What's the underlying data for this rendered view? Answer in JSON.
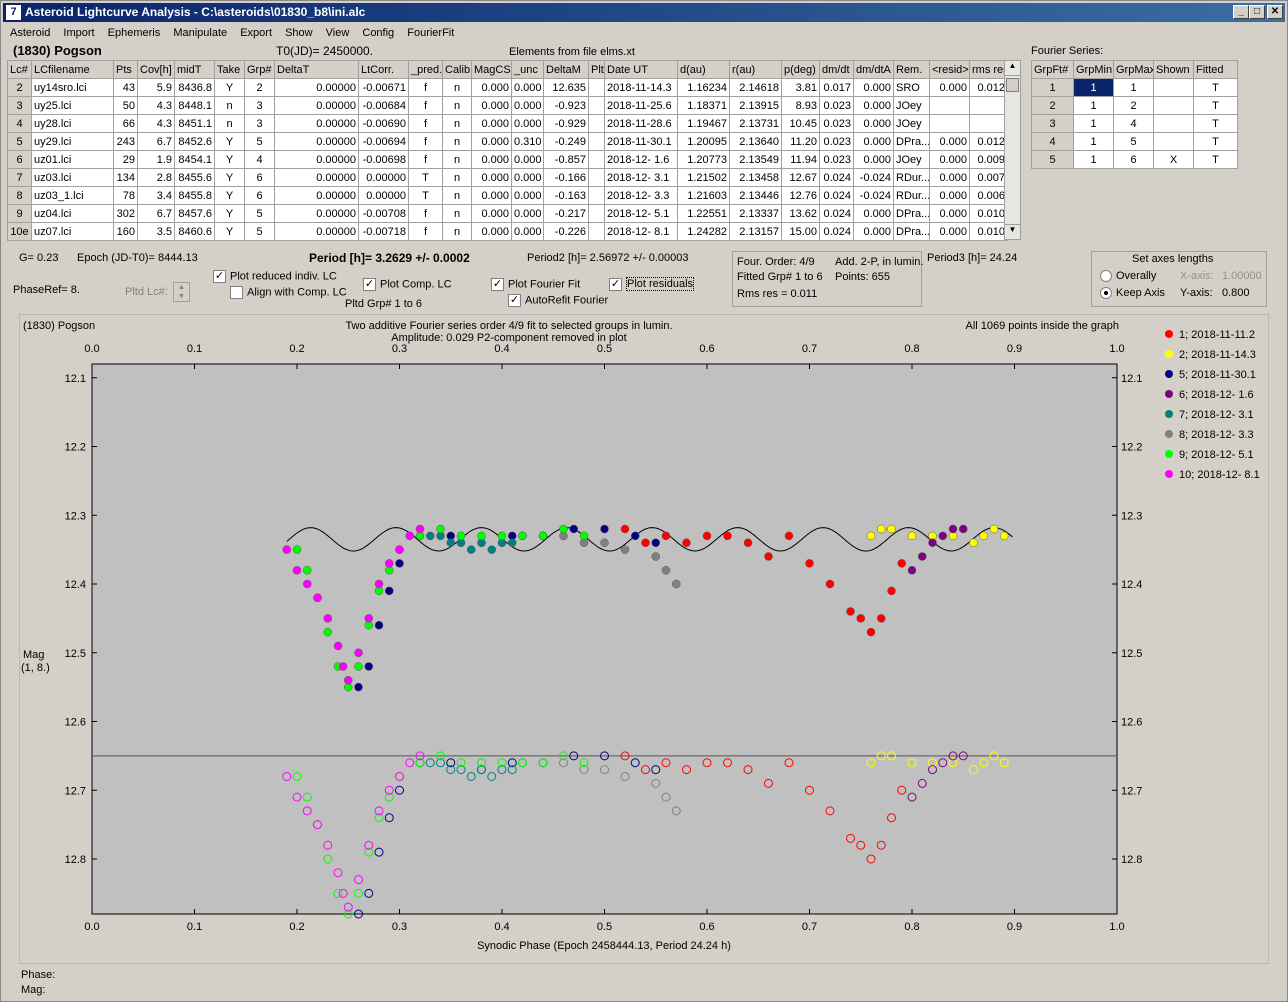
{
  "window": {
    "title": "Asteroid Lightcurve Analysis - C:\\asteroids\\01830_b8\\ini.alc"
  },
  "menu": [
    "Asteroid",
    "Import",
    "Ephemeris",
    "Manipulate",
    "Export",
    "Show",
    "View",
    "Config",
    "FourierFit"
  ],
  "header": {
    "asteroid": "(1830) Pogson",
    "t0": "T0(JD)= 2450000.",
    "elements": "Elements from file elms.xt",
    "fourier_title": "Fourier Series:"
  },
  "lc_table": {
    "columns": [
      "Lc#",
      "LCfilename",
      "Pts",
      "Cov[h]",
      "midT",
      "Take",
      "Grp#",
      "DeltaT",
      "LtCorr.",
      "_pred.",
      "Calib",
      "MagCS",
      "_unc",
      "DeltaM",
      "Plt",
      "Date UT",
      "d(au)",
      "r(au)",
      "p(deg)",
      "dm/dt",
      "dm/dtA",
      "Rem.",
      "<resid>",
      "rms res"
    ],
    "rows": [
      [
        "2",
        "uy14sro.lci",
        "43",
        "5.9",
        "8436.8",
        "Y",
        "2",
        "0.00000",
        "-0.00671",
        "f",
        "n",
        "0.000",
        "0.000",
        "12.635",
        "",
        "2018-11-14.3",
        "1.16234",
        "2.14618",
        "3.81",
        "0.017",
        "0.000",
        "SRO",
        "0.000",
        "0.012"
      ],
      [
        "3",
        "uy25.lci",
        "50",
        "4.3",
        "8448.1",
        "n",
        "3",
        "0.00000",
        "-0.00684",
        "f",
        "n",
        "0.000",
        "0.000",
        "-0.923",
        "",
        "2018-11-25.6",
        "1.18371",
        "2.13915",
        "8.93",
        "0.023",
        "0.000",
        "JOey",
        "",
        ""
      ],
      [
        "4",
        "uy28.lci",
        "66",
        "4.3",
        "8451.1",
        "n",
        "3",
        "0.00000",
        "-0.00690",
        "f",
        "n",
        "0.000",
        "0.000",
        "-0.929",
        "",
        "2018-11-28.6",
        "1.19467",
        "2.13731",
        "10.45",
        "0.023",
        "0.000",
        "JOey",
        "",
        ""
      ],
      [
        "5",
        "uy29.lci",
        "243",
        "6.7",
        "8452.6",
        "Y",
        "5",
        "0.00000",
        "-0.00694",
        "f",
        "n",
        "0.000",
        "0.310",
        "-0.249",
        "",
        "2018-11-30.1",
        "1.20095",
        "2.13640",
        "11.20",
        "0.023",
        "0.000",
        "DPra...",
        "0.000",
        "0.012"
      ],
      [
        "6",
        "uz01.lci",
        "29",
        "1.9",
        "8454.1",
        "Y",
        "4",
        "0.00000",
        "-0.00698",
        "f",
        "n",
        "0.000",
        "0.000",
        "-0.857",
        "",
        "2018-12- 1.6",
        "1.20773",
        "2.13549",
        "11.94",
        "0.023",
        "0.000",
        "JOey",
        "0.000",
        "0.009"
      ],
      [
        "7",
        "uz03.lci",
        "134",
        "2.8",
        "8455.6",
        "Y",
        "6",
        "0.00000",
        "0.00000",
        "T",
        "n",
        "0.000",
        "0.000",
        "-0.166",
        "",
        "2018-12- 3.1",
        "1.21502",
        "2.13458",
        "12.67",
        "0.024",
        "-0.024",
        "RDur...",
        "0.000",
        "0.007"
      ],
      [
        "8",
        "uz03_1.lci",
        "78",
        "3.4",
        "8455.8",
        "Y",
        "6",
        "0.00000",
        "0.00000",
        "T",
        "n",
        "0.000",
        "0.000",
        "-0.163",
        "",
        "2018-12- 3.3",
        "1.21603",
        "2.13446",
        "12.76",
        "0.024",
        "-0.024",
        "RDur...",
        "0.000",
        "0.006"
      ],
      [
        "9",
        "uz04.lci",
        "302",
        "6.7",
        "8457.6",
        "Y",
        "5",
        "0.00000",
        "-0.00708",
        "f",
        "n",
        "0.000",
        "0.000",
        "-0.217",
        "",
        "2018-12- 5.1",
        "1.22551",
        "2.13337",
        "13.62",
        "0.024",
        "0.000",
        "DPra...",
        "0.000",
        "0.010"
      ],
      [
        "10e",
        "uz07.lci",
        "160",
        "3.5",
        "8460.6",
        "Y",
        "5",
        "0.00000",
        "-0.00718",
        "f",
        "n",
        "0.000",
        "0.000",
        "-0.226",
        "",
        "2018-12- 8.1",
        "1.24282",
        "2.13157",
        "15.00",
        "0.024",
        "0.000",
        "DPra...",
        "0.000",
        "0.010"
      ]
    ]
  },
  "fourier_table": {
    "columns": [
      "GrpFt#",
      "GrpMin",
      "GrpMax",
      "Shown",
      "Fitted"
    ],
    "rows": [
      [
        "1",
        "1",
        "1",
        "",
        "T"
      ],
      [
        "2",
        "1",
        "2",
        "",
        "T"
      ],
      [
        "3",
        "1",
        "4",
        "",
        "T"
      ],
      [
        "4",
        "1",
        "5",
        "",
        "T"
      ],
      [
        "5",
        "1",
        "6",
        "X",
        "T"
      ]
    ]
  },
  "info": {
    "g": "G= 0.23",
    "epoch": "Epoch (JD-T0)= 8444.13",
    "period": "Period [h]= 3.2629 +/- 0.0002",
    "period2": "Period2 [h]= 2.56972 +/- 0.00003",
    "period3": "Period3 [h]= 24.24",
    "phase_ref": "PhaseRef= 8.",
    "pltd_lc": "Pltd Lc#:",
    "pltd_grp": "Pltd Grp#  1  to  6"
  },
  "checkboxes": {
    "plot_reduced": {
      "label": "Plot reduced indiv. LC",
      "checked": "✓"
    },
    "align_comp": {
      "label": "Align with Comp. LC",
      "checked": ""
    },
    "plot_comp": {
      "label": "Plot Comp. LC",
      "checked": "✓"
    },
    "plot_fourier": {
      "label": "Plot Fourier Fit",
      "checked": "✓"
    },
    "plot_residuals": {
      "label": "Plot residuals",
      "checked": "✓"
    },
    "autorefit": {
      "label": "AutoRefit Fourier",
      "checked": "✓"
    }
  },
  "fit_info": {
    "order": "Four. Order:  4/9",
    "add": "Add. 2-P, in lumin.",
    "fitted": "Fitted Grp# 1 to 6",
    "points": "Points: 655",
    "rms": "Rms res     = 0.011"
  },
  "axes_panel": {
    "title": "Set axes lengths",
    "overally": "Overally",
    "keep_axis": "Keep Axis",
    "xaxis_label": "X-axis:",
    "xaxis_value": "1.00000",
    "yaxis_label": "Y-axis:",
    "yaxis_value": "0.800"
  },
  "footer": {
    "phase": "Phase:",
    "mag": "Mag:"
  },
  "chart_data": {
    "type": "scatter",
    "title": "Two additive Fourier series order 4/9 fit to selected groups in lumin.",
    "subtitle": "Amplitude: 0.029          P2-component removed in plot",
    "object_label": "(1830) Pogson",
    "points_note": "All 1069 points inside the graph",
    "xlabel": "Synodic Phase (Epoch 2458444.13, Period 24.24 h)",
    "ylabel": "Mag",
    "ylabel2": "(1, 8.)",
    "xlim": [
      0,
      1
    ],
    "ylim": [
      12.8,
      12.1
    ],
    "x_ticks": [
      "0.0",
      "0.1",
      "0.2",
      "0.3",
      "0.4",
      "0.5",
      "0.6",
      "0.7",
      "0.8",
      "0.9",
      "1.0"
    ],
    "y_ticks": [
      "12.1",
      "12.2",
      "12.3",
      "12.4",
      "12.5",
      "12.6",
      "12.7",
      "12.8"
    ],
    "residual_offset": 0.33,
    "reference_line": 12.65,
    "legend": "right",
    "series": [
      {
        "name": "1; 2018-11-11.2",
        "color": "#ff0000",
        "x": [
          0.52,
          0.54,
          0.56,
          0.58,
          0.6,
          0.62,
          0.64,
          0.66,
          0.68,
          0.7,
          0.72,
          0.74,
          0.75,
          0.76,
          0.77,
          0.78,
          0.79
        ],
        "y": [
          12.32,
          12.34,
          12.33,
          12.34,
          12.33,
          12.33,
          12.34,
          12.36,
          12.33,
          12.37,
          12.4,
          12.44,
          12.45,
          12.47,
          12.45,
          12.41,
          12.37
        ]
      },
      {
        "name": "2; 2018-11-14.3",
        "color": "#ffff00",
        "x": [
          0.76,
          0.77,
          0.78,
          0.8,
          0.82,
          0.84,
          0.86,
          0.87,
          0.88,
          0.89
        ],
        "y": [
          12.33,
          12.32,
          12.32,
          12.33,
          12.33,
          12.33,
          12.34,
          12.33,
          12.32,
          12.33
        ]
      },
      {
        "name": "5; 2018-11-30.1",
        "color": "#000080",
        "x": [
          0.26,
          0.27,
          0.28,
          0.29,
          0.3,
          0.32,
          0.35,
          0.38,
          0.41,
          0.44,
          0.47,
          0.5,
          0.53,
          0.55
        ],
        "y": [
          12.55,
          12.52,
          12.46,
          12.41,
          12.37,
          12.33,
          12.33,
          12.34,
          12.33,
          12.33,
          12.32,
          12.32,
          12.33,
          12.34
        ]
      },
      {
        "name": "6; 2018-12- 1.6",
        "color": "#800080",
        "x": [
          0.8,
          0.81,
          0.82,
          0.83,
          0.84,
          0.85
        ],
        "y": [
          12.38,
          12.36,
          12.34,
          12.33,
          12.32,
          12.32
        ]
      },
      {
        "name": "7; 2018-12- 3.1",
        "color": "#008080",
        "x": [
          0.33,
          0.34,
          0.35,
          0.36,
          0.37,
          0.38,
          0.39,
          0.4,
          0.41,
          0.42
        ],
        "y": [
          12.33,
          12.33,
          12.34,
          12.34,
          12.35,
          12.34,
          12.35,
          12.34,
          12.34,
          12.33
        ]
      },
      {
        "name": "8; 2018-12- 3.3",
        "color": "#808080",
        "x": [
          0.44,
          0.46,
          0.48,
          0.5,
          0.52,
          0.55,
          0.56,
          0.57
        ],
        "y": [
          12.33,
          12.33,
          12.34,
          12.34,
          12.35,
          12.36,
          12.38,
          12.4
        ]
      },
      {
        "name": "9; 2018-12- 5.1",
        "color": "#00ff00",
        "x": [
          0.2,
          0.21,
          0.22,
          0.23,
          0.24,
          0.25,
          0.26,
          0.27,
          0.28,
          0.29,
          0.3,
          0.32,
          0.34,
          0.36,
          0.38,
          0.4,
          0.42,
          0.44,
          0.46,
          0.48
        ],
        "y": [
          12.35,
          12.38,
          12.42,
          12.47,
          12.52,
          12.55,
          12.52,
          12.46,
          12.41,
          12.38,
          12.35,
          12.33,
          12.32,
          12.33,
          12.33,
          12.33,
          12.33,
          12.33,
          12.32,
          12.33
        ]
      },
      {
        "name": "10; 2018-12- 8.1",
        "color": "#ff00ff",
        "x": [
          0.19,
          0.2,
          0.21,
          0.22,
          0.23,
          0.24,
          0.245,
          0.25,
          0.26,
          0.27,
          0.28,
          0.29,
          0.3,
          0.31,
          0.32
        ],
        "y": [
          12.35,
          12.38,
          12.4,
          12.42,
          12.45,
          12.49,
          12.52,
          12.54,
          12.5,
          12.45,
          12.4,
          12.37,
          12.35,
          12.33,
          12.32
        ]
      }
    ]
  }
}
